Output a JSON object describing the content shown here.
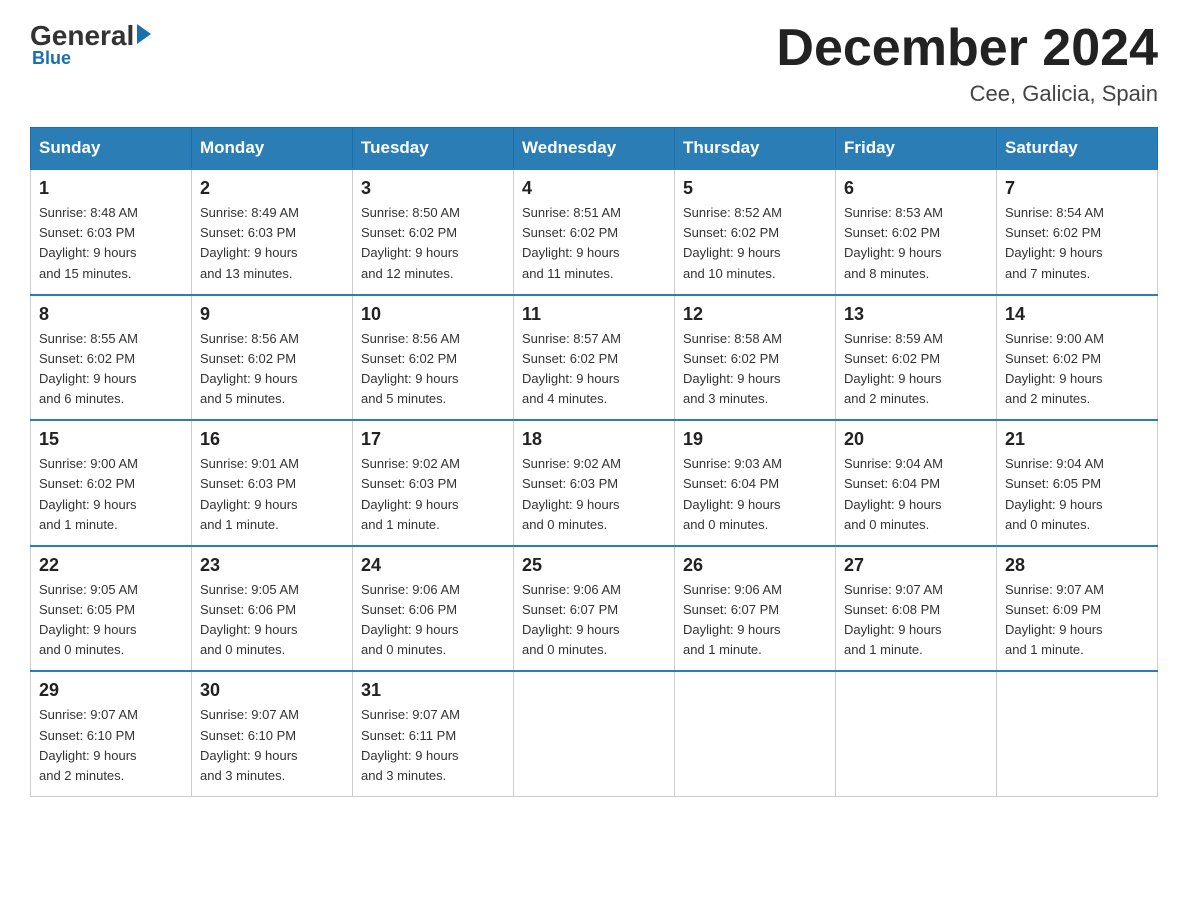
{
  "logo": {
    "general": "General",
    "triangle": "",
    "blue_line": "Blue"
  },
  "header": {
    "month_title": "December 2024",
    "subtitle": "Cee, Galicia, Spain"
  },
  "days_of_week": [
    "Sunday",
    "Monday",
    "Tuesday",
    "Wednesday",
    "Thursday",
    "Friday",
    "Saturday"
  ],
  "weeks": [
    [
      {
        "num": "1",
        "info": "Sunrise: 8:48 AM\nSunset: 6:03 PM\nDaylight: 9 hours\nand 15 minutes."
      },
      {
        "num": "2",
        "info": "Sunrise: 8:49 AM\nSunset: 6:03 PM\nDaylight: 9 hours\nand 13 minutes."
      },
      {
        "num": "3",
        "info": "Sunrise: 8:50 AM\nSunset: 6:02 PM\nDaylight: 9 hours\nand 12 minutes."
      },
      {
        "num": "4",
        "info": "Sunrise: 8:51 AM\nSunset: 6:02 PM\nDaylight: 9 hours\nand 11 minutes."
      },
      {
        "num": "5",
        "info": "Sunrise: 8:52 AM\nSunset: 6:02 PM\nDaylight: 9 hours\nand 10 minutes."
      },
      {
        "num": "6",
        "info": "Sunrise: 8:53 AM\nSunset: 6:02 PM\nDaylight: 9 hours\nand 8 minutes."
      },
      {
        "num": "7",
        "info": "Sunrise: 8:54 AM\nSunset: 6:02 PM\nDaylight: 9 hours\nand 7 minutes."
      }
    ],
    [
      {
        "num": "8",
        "info": "Sunrise: 8:55 AM\nSunset: 6:02 PM\nDaylight: 9 hours\nand 6 minutes."
      },
      {
        "num": "9",
        "info": "Sunrise: 8:56 AM\nSunset: 6:02 PM\nDaylight: 9 hours\nand 5 minutes."
      },
      {
        "num": "10",
        "info": "Sunrise: 8:56 AM\nSunset: 6:02 PM\nDaylight: 9 hours\nand 5 minutes."
      },
      {
        "num": "11",
        "info": "Sunrise: 8:57 AM\nSunset: 6:02 PM\nDaylight: 9 hours\nand 4 minutes."
      },
      {
        "num": "12",
        "info": "Sunrise: 8:58 AM\nSunset: 6:02 PM\nDaylight: 9 hours\nand 3 minutes."
      },
      {
        "num": "13",
        "info": "Sunrise: 8:59 AM\nSunset: 6:02 PM\nDaylight: 9 hours\nand 2 minutes."
      },
      {
        "num": "14",
        "info": "Sunrise: 9:00 AM\nSunset: 6:02 PM\nDaylight: 9 hours\nand 2 minutes."
      }
    ],
    [
      {
        "num": "15",
        "info": "Sunrise: 9:00 AM\nSunset: 6:02 PM\nDaylight: 9 hours\nand 1 minute."
      },
      {
        "num": "16",
        "info": "Sunrise: 9:01 AM\nSunset: 6:03 PM\nDaylight: 9 hours\nand 1 minute."
      },
      {
        "num": "17",
        "info": "Sunrise: 9:02 AM\nSunset: 6:03 PM\nDaylight: 9 hours\nand 1 minute."
      },
      {
        "num": "18",
        "info": "Sunrise: 9:02 AM\nSunset: 6:03 PM\nDaylight: 9 hours\nand 0 minutes."
      },
      {
        "num": "19",
        "info": "Sunrise: 9:03 AM\nSunset: 6:04 PM\nDaylight: 9 hours\nand 0 minutes."
      },
      {
        "num": "20",
        "info": "Sunrise: 9:04 AM\nSunset: 6:04 PM\nDaylight: 9 hours\nand 0 minutes."
      },
      {
        "num": "21",
        "info": "Sunrise: 9:04 AM\nSunset: 6:05 PM\nDaylight: 9 hours\nand 0 minutes."
      }
    ],
    [
      {
        "num": "22",
        "info": "Sunrise: 9:05 AM\nSunset: 6:05 PM\nDaylight: 9 hours\nand 0 minutes."
      },
      {
        "num": "23",
        "info": "Sunrise: 9:05 AM\nSunset: 6:06 PM\nDaylight: 9 hours\nand 0 minutes."
      },
      {
        "num": "24",
        "info": "Sunrise: 9:06 AM\nSunset: 6:06 PM\nDaylight: 9 hours\nand 0 minutes."
      },
      {
        "num": "25",
        "info": "Sunrise: 9:06 AM\nSunset: 6:07 PM\nDaylight: 9 hours\nand 0 minutes."
      },
      {
        "num": "26",
        "info": "Sunrise: 9:06 AM\nSunset: 6:07 PM\nDaylight: 9 hours\nand 1 minute."
      },
      {
        "num": "27",
        "info": "Sunrise: 9:07 AM\nSunset: 6:08 PM\nDaylight: 9 hours\nand 1 minute."
      },
      {
        "num": "28",
        "info": "Sunrise: 9:07 AM\nSunset: 6:09 PM\nDaylight: 9 hours\nand 1 minute."
      }
    ],
    [
      {
        "num": "29",
        "info": "Sunrise: 9:07 AM\nSunset: 6:10 PM\nDaylight: 9 hours\nand 2 minutes."
      },
      {
        "num": "30",
        "info": "Sunrise: 9:07 AM\nSunset: 6:10 PM\nDaylight: 9 hours\nand 3 minutes."
      },
      {
        "num": "31",
        "info": "Sunrise: 9:07 AM\nSunset: 6:11 PM\nDaylight: 9 hours\nand 3 minutes."
      },
      null,
      null,
      null,
      null
    ]
  ]
}
